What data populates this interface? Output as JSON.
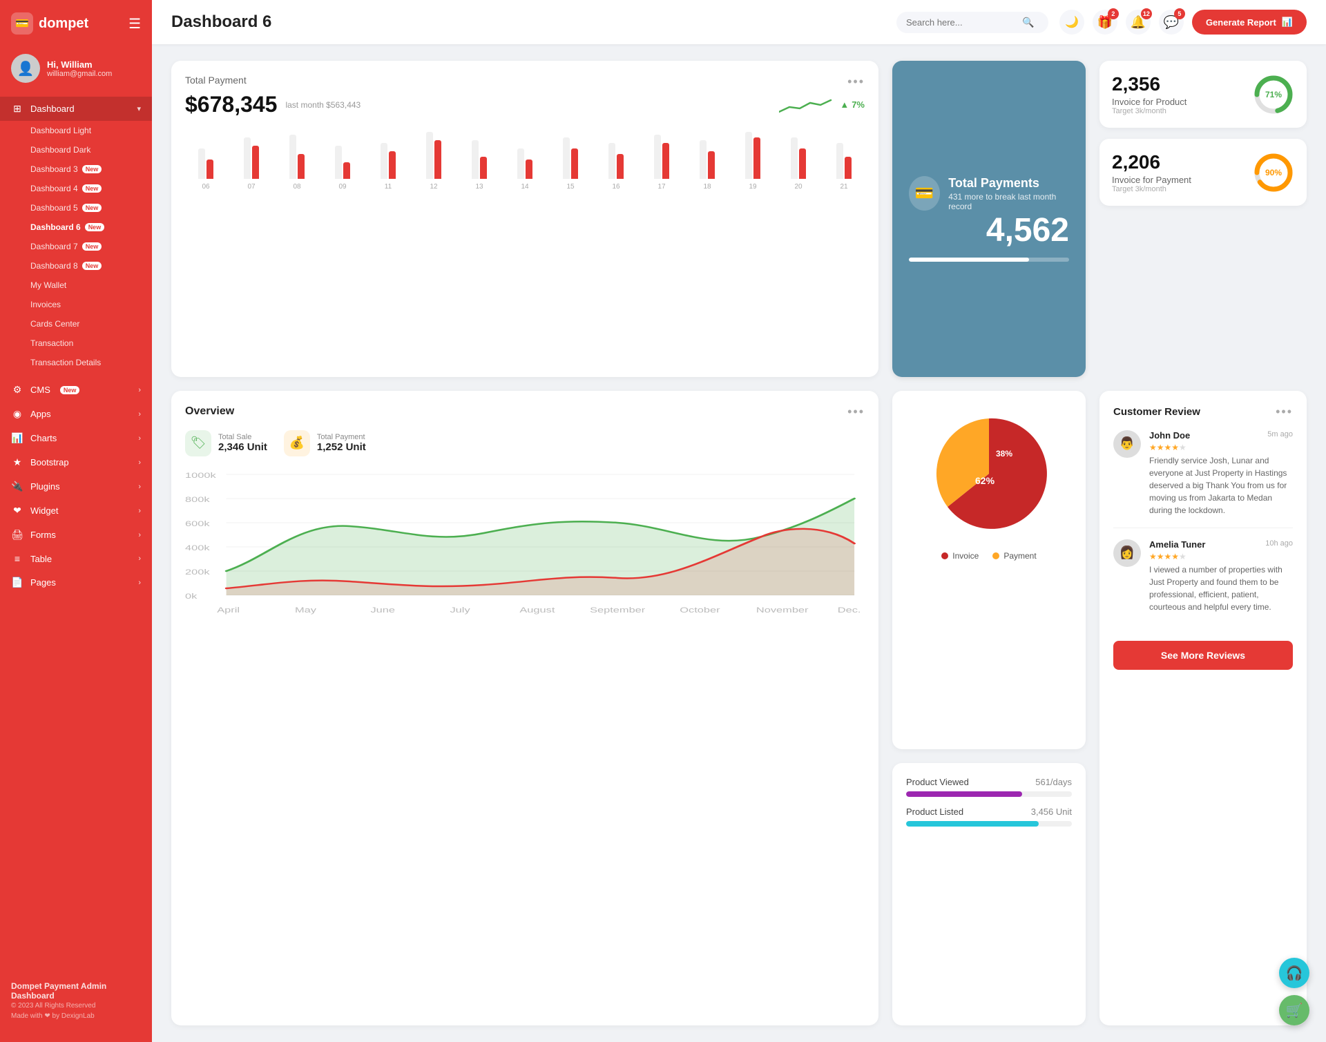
{
  "app": {
    "name": "dompet",
    "tagline": "Dompet Payment Admin Dashboard",
    "copyright": "© 2023 All Rights Reserved",
    "made_with": "Made with ❤ by DexignLab"
  },
  "user": {
    "greeting": "Hi, William",
    "email": "william@gmail.com"
  },
  "topbar": {
    "page_title": "Dashboard 6",
    "search_placeholder": "Search here...",
    "generate_btn": "Generate Report",
    "badges": {
      "gift": "2",
      "bell": "12",
      "chat": "5"
    }
  },
  "sidebar": {
    "dashboard_label": "Dashboard",
    "items": [
      {
        "label": "Dashboard Light",
        "sub": true,
        "new": false
      },
      {
        "label": "Dashboard Dark",
        "sub": true,
        "new": false
      },
      {
        "label": "Dashboard 3",
        "sub": true,
        "new": true
      },
      {
        "label": "Dashboard 4",
        "sub": true,
        "new": true
      },
      {
        "label": "Dashboard 5",
        "sub": true,
        "new": true
      },
      {
        "label": "Dashboard 6",
        "sub": true,
        "new": true,
        "active": true
      },
      {
        "label": "Dashboard 7",
        "sub": true,
        "new": true
      },
      {
        "label": "Dashboard 8",
        "sub": true,
        "new": true
      },
      {
        "label": "My Wallet",
        "sub": true,
        "new": false
      },
      {
        "label": "Invoices",
        "sub": true,
        "new": false
      },
      {
        "label": "Cards Center",
        "sub": true,
        "new": false
      },
      {
        "label": "Transaction",
        "sub": true,
        "new": false
      },
      {
        "label": "Transaction Details",
        "sub": true,
        "new": false
      }
    ],
    "menu": [
      {
        "label": "CMS",
        "icon": "⚙",
        "new": true,
        "arrow": true
      },
      {
        "label": "Apps",
        "icon": "◉",
        "new": false,
        "arrow": true
      },
      {
        "label": "Charts",
        "icon": "📊",
        "new": false,
        "arrow": true
      },
      {
        "label": "Bootstrap",
        "icon": "★",
        "new": false,
        "arrow": true
      },
      {
        "label": "Plugins",
        "icon": "❤",
        "new": false,
        "arrow": true
      },
      {
        "label": "Widget",
        "icon": "❤",
        "new": false,
        "arrow": true
      },
      {
        "label": "Forms",
        "icon": "🖨",
        "new": false,
        "arrow": true
      },
      {
        "label": "Table",
        "icon": "≡",
        "new": false,
        "arrow": true
      },
      {
        "label": "Pages",
        "icon": "📄",
        "new": false,
        "arrow": true
      }
    ]
  },
  "total_payment": {
    "title": "Total Payment",
    "amount": "$678,345",
    "last_month_label": "last month $563,443",
    "trend": "7%",
    "trend_up": true,
    "bars": [
      {
        "label": "06",
        "red": 35,
        "light": 55
      },
      {
        "label": "07",
        "red": 60,
        "light": 75
      },
      {
        "label": "08",
        "red": 45,
        "light": 80
      },
      {
        "label": "09",
        "red": 30,
        "light": 60
      },
      {
        "label": "11",
        "red": 50,
        "light": 65
      },
      {
        "label": "12",
        "red": 70,
        "light": 85
      },
      {
        "label": "13",
        "red": 40,
        "light": 70
      },
      {
        "label": "14",
        "red": 35,
        "light": 55
      },
      {
        "label": "15",
        "red": 55,
        "light": 75
      },
      {
        "label": "16",
        "red": 45,
        "light": 65
      },
      {
        "label": "17",
        "red": 65,
        "light": 80
      },
      {
        "label": "18",
        "red": 50,
        "light": 70
      },
      {
        "label": "19",
        "red": 75,
        "light": 85
      },
      {
        "label": "20",
        "red": 55,
        "light": 75
      },
      {
        "label": "21",
        "red": 40,
        "light": 65
      }
    ]
  },
  "total_payments_card": {
    "title": "Total Payments",
    "number": "4,562",
    "sub": "431 more to break last month record",
    "progress": 75
  },
  "invoice_product": {
    "invoice_number": "2,356",
    "invoice_label": "Invoice for Product",
    "invoice_target": "Target 3k/month",
    "invoice_percent": 71,
    "invoice_color": "#4caf50",
    "payment_number": "2,206",
    "payment_label": "Invoice for Payment",
    "payment_target": "Target 3k/month",
    "payment_percent": 90,
    "payment_color": "#ff9800"
  },
  "overview": {
    "title": "Overview",
    "total_sale_label": "Total Sale",
    "total_sale_value": "2,346 Unit",
    "total_payment_label": "Total Payment",
    "total_payment_value": "1,252 Unit",
    "y_labels": [
      "1000k",
      "800k",
      "600k",
      "400k",
      "200k",
      "0k"
    ],
    "x_labels": [
      "April",
      "May",
      "June",
      "July",
      "August",
      "September",
      "October",
      "November",
      "Dec."
    ]
  },
  "pie_chart": {
    "invoice_pct": 62,
    "payment_pct": 38,
    "invoice_color": "#c62828",
    "payment_color": "#ffa726",
    "invoice_label": "Invoice",
    "payment_label": "Payment"
  },
  "product_stats": {
    "viewed_label": "Product Viewed",
    "viewed_value": "561/days",
    "viewed_color": "#9c27b0",
    "viewed_pct": 70,
    "listed_label": "Product Listed",
    "listed_value": "3,456 Unit",
    "listed_color": "#26c6da",
    "listed_pct": 80
  },
  "customer_review": {
    "title": "Customer Review",
    "reviews": [
      {
        "name": "John Doe",
        "time": "5m ago",
        "stars": 4,
        "text": "Friendly service Josh, Lunar and everyone at Just Property in Hastings deserved a big Thank You from us for moving us from Jakarta to Medan during the lockdown."
      },
      {
        "name": "Amelia Tuner",
        "time": "10h ago",
        "stars": 4,
        "text": "I viewed a number of properties with Just Property and found them to be professional, efficient, patient, courteous and helpful every time."
      }
    ],
    "see_more": "See More Reviews"
  }
}
